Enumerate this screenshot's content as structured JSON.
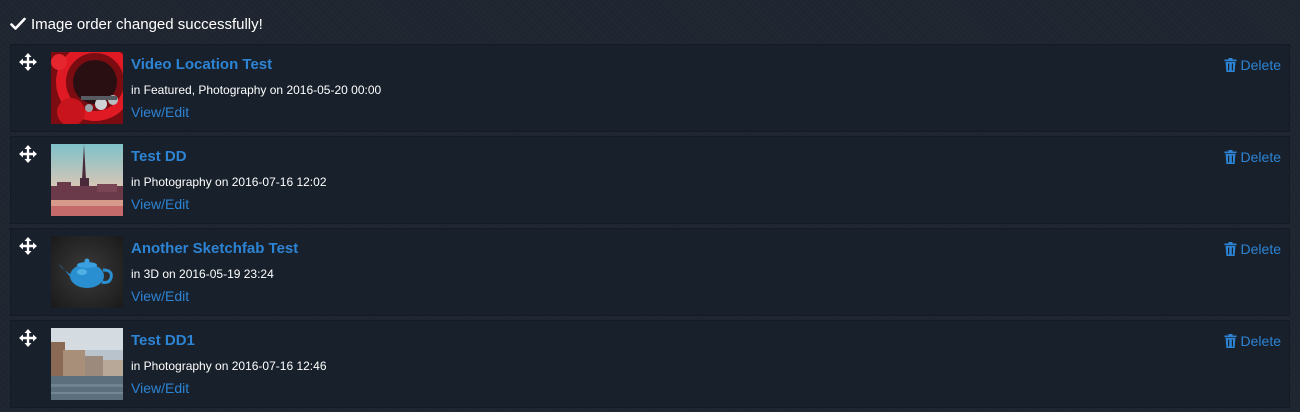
{
  "status": {
    "icon": "check-icon",
    "message": "Image order changed successfully!"
  },
  "colors": {
    "link": "#2d84d4",
    "background": "#1e2530",
    "row_background": "#18202b"
  },
  "items": [
    {
      "title": "Video Location Test",
      "meta": "in Featured, Photography on 2016-05-20 00:00",
      "view_label": "View/Edit",
      "delete_label": "Delete",
      "thumbnail": "dashboard-gauges-photo"
    },
    {
      "title": "Test DD",
      "meta": "in Photography on 2016-07-16 12:02",
      "view_label": "View/Edit",
      "delete_label": "Delete",
      "thumbnail": "city-spire-photo"
    },
    {
      "title": "Another Sketchfab Test",
      "meta": "in 3D on 2016-05-19 23:24",
      "view_label": "View/Edit",
      "delete_label": "Delete",
      "thumbnail": "teapot-render"
    },
    {
      "title": "Test DD1",
      "meta": "in Photography on 2016-07-16 12:46",
      "view_label": "View/Edit",
      "delete_label": "Delete",
      "thumbnail": "waterfront-photo"
    }
  ]
}
